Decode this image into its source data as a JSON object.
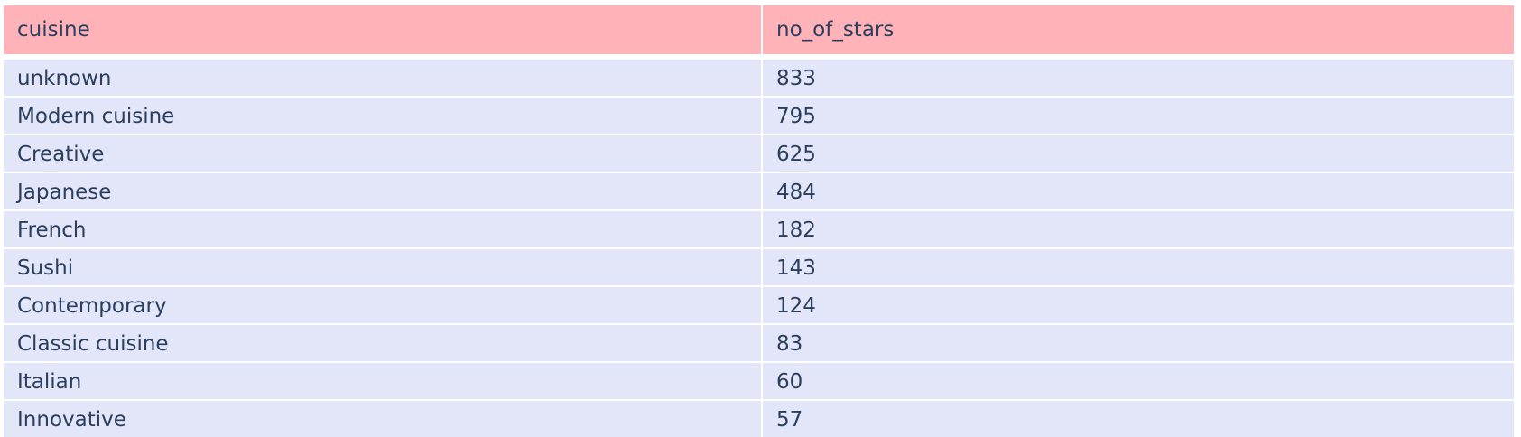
{
  "chart_data": {
    "type": "table",
    "header": [
      "cuisine",
      "no_of_stars"
    ],
    "rows": [
      [
        "unknown",
        "833"
      ],
      [
        "Modern cuisine",
        "795"
      ],
      [
        "Creative",
        "625"
      ],
      [
        "Japanese",
        "484"
      ],
      [
        "French",
        "182"
      ],
      [
        "Sushi",
        "143"
      ],
      [
        "Contemporary",
        "124"
      ],
      [
        "Classic cuisine",
        "83"
      ],
      [
        "Italian",
        "60"
      ],
      [
        "Innovative",
        "57"
      ]
    ],
    "colors": {
      "header_fill": "#ffb3b8",
      "cell_fill": "#e3e5f8",
      "font_color": "#2a3f5f"
    }
  }
}
